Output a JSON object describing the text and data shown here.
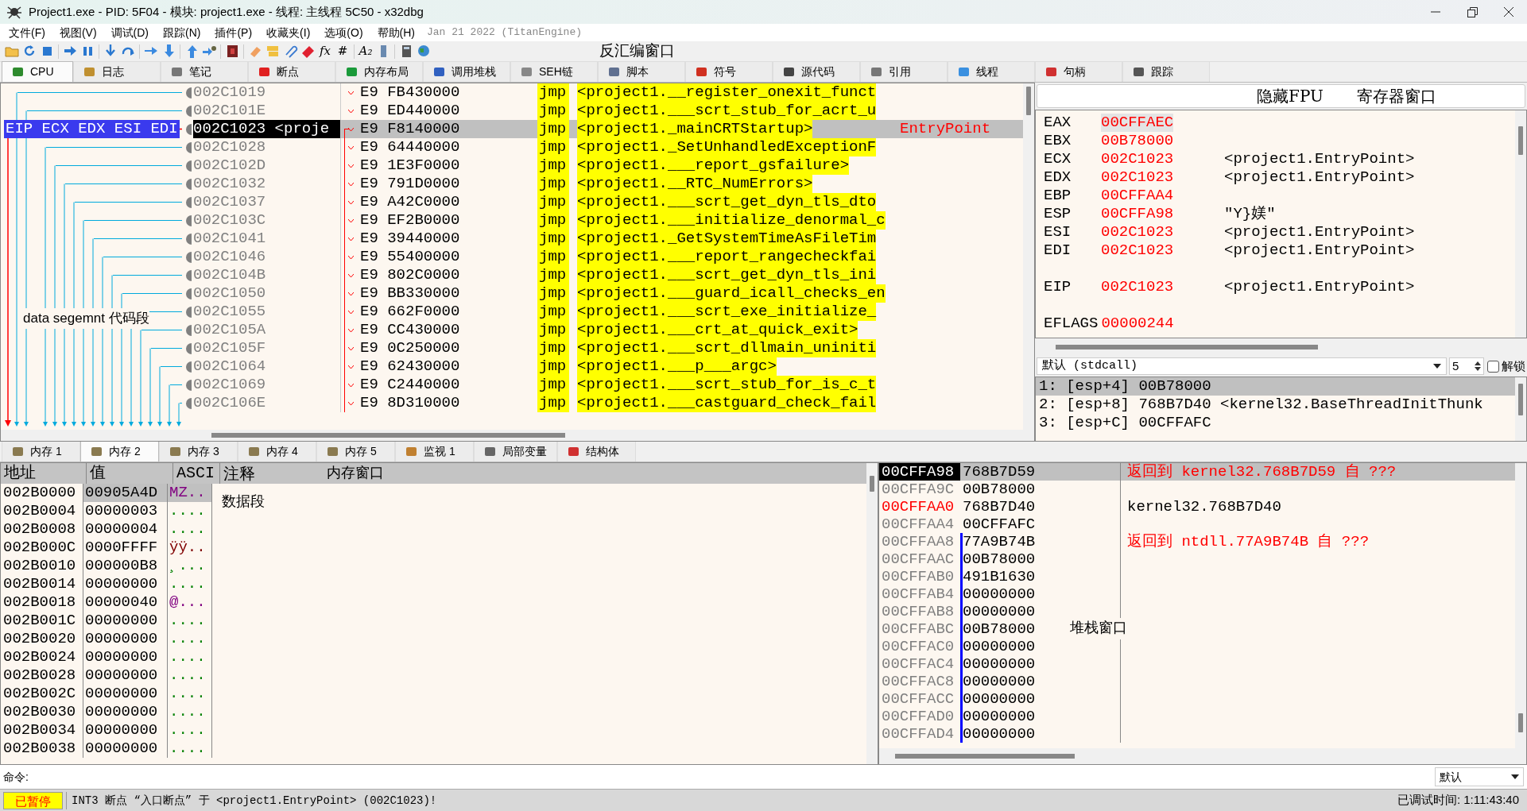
{
  "window": {
    "title": "Project1.exe - PID: 5F04 - 模块: project1.exe - 线程: 主线程 5C50 - x32dbg"
  },
  "menu": {
    "items": [
      "文件(F)",
      "视图(V)",
      "调试(D)",
      "跟踪(N)",
      "插件(P)",
      "收藏夹(I)",
      "选项(O)",
      "帮助(H)"
    ],
    "build_info": "Jan 21 2022 (TitanEngine)"
  },
  "toolbar": {
    "text_buttons": [
      "fx",
      "#",
      "A₂"
    ],
    "annotation": "反汇编窗口"
  },
  "top_tabs": [
    {
      "label": "CPU",
      "selected": true
    },
    {
      "label": "日志",
      "selected": false
    },
    {
      "label": "笔记",
      "selected": false
    },
    {
      "label": "断点",
      "selected": false
    },
    {
      "label": "内存布局",
      "selected": false
    },
    {
      "label": "调用堆栈",
      "selected": false
    },
    {
      "label": "SEH链",
      "selected": false
    },
    {
      "label": "脚本",
      "selected": false
    },
    {
      "label": "符号",
      "selected": false
    },
    {
      "label": "源代码",
      "selected": false
    },
    {
      "label": "引用",
      "selected": false
    },
    {
      "label": "线程",
      "selected": false
    },
    {
      "label": "句柄",
      "selected": false
    },
    {
      "label": "跟踪",
      "selected": false
    }
  ],
  "disassembly": {
    "register_label": "EIP ECX EDX ESI EDI",
    "annotation": "data segemnt 代码段",
    "rows": [
      {
        "address": "002C1019",
        "bytes": "E9 FB430000",
        "mnemonic": "jmp",
        "operand": "<project1.__register_onexit_funct",
        "selected": false
      },
      {
        "address": "002C101E",
        "bytes": "E9 ED440000",
        "mnemonic": "jmp",
        "operand": "<project1.___scrt_stub_for_acrt_u",
        "selected": false
      },
      {
        "address": "002C1023 <proje",
        "bytes": "E9 F8140000",
        "mnemonic": "jmp",
        "operand": "<project1._mainCRTStartup>",
        "comment": "EntryPoint",
        "selected": true
      },
      {
        "address": "002C1028",
        "bytes": "E9 64440000",
        "mnemonic": "jmp",
        "operand": "<project1._SetUnhandledExceptionF",
        "selected": false
      },
      {
        "address": "002C102D",
        "bytes": "E9 1E3F0000",
        "mnemonic": "jmp",
        "operand": "<project1.___report_gsfailure>",
        "selected": false
      },
      {
        "address": "002C1032",
        "bytes": "E9 791D0000",
        "mnemonic": "jmp",
        "operand": "<project1.__RTC_NumErrors>",
        "selected": false
      },
      {
        "address": "002C1037",
        "bytes": "E9 A42C0000",
        "mnemonic": "jmp",
        "operand": "<project1.___scrt_get_dyn_tls_dto",
        "selected": false
      },
      {
        "address": "002C103C",
        "bytes": "E9 EF2B0000",
        "mnemonic": "jmp",
        "operand": "<project1.___initialize_denormal_c",
        "selected": false
      },
      {
        "address": "002C1041",
        "bytes": "E9 39440000",
        "mnemonic": "jmp",
        "operand": "<project1._GetSystemTimeAsFileTim",
        "selected": false
      },
      {
        "address": "002C1046",
        "bytes": "E9 55400000",
        "mnemonic": "jmp",
        "operand": "<project1.___report_rangecheckfai",
        "selected": false
      },
      {
        "address": "002C104B",
        "bytes": "E9 802C0000",
        "mnemonic": "jmp",
        "operand": "<project1.___scrt_get_dyn_tls_ini",
        "selected": false
      },
      {
        "address": "002C1050",
        "bytes": "E9 BB330000",
        "mnemonic": "jmp",
        "operand": "<project1.___guard_icall_checks_en",
        "selected": false
      },
      {
        "address": "002C1055",
        "bytes": "E9 662F0000",
        "mnemonic": "jmp",
        "operand": "<project1.___scrt_exe_initialize_",
        "selected": false
      },
      {
        "address": "002C105A",
        "bytes": "E9 CC430000",
        "mnemonic": "jmp",
        "operand": "<project1.___crt_at_quick_exit>",
        "selected": false
      },
      {
        "address": "002C105F",
        "bytes": "E9 0C250000",
        "mnemonic": "jmp",
        "operand": "<project1.___scrt_dllmain_uniniti",
        "selected": false
      },
      {
        "address": "002C1064",
        "bytes": "E9 62430000",
        "mnemonic": "jmp",
        "operand": "<project1.___p___argc>",
        "selected": false
      },
      {
        "address": "002C1069",
        "bytes": "E9 C2440000",
        "mnemonic": "jmp",
        "operand": "<project1.___scrt_stub_for_is_c_t",
        "selected": false
      },
      {
        "address": "002C106E",
        "bytes": "E9 8D310000",
        "mnemonic": "jmp",
        "operand": "<project1.___castguard_check_fail",
        "selected": false
      }
    ]
  },
  "registers": {
    "fpu_button": "隐藏FPU",
    "annotation": "寄存器窗口",
    "groups": [
      [
        {
          "name": "EAX",
          "value": "00CFFAEC",
          "selected": true
        },
        {
          "name": "EBX",
          "value": "00B78000",
          "selected": false
        },
        {
          "name": "ECX",
          "value": "002C1023",
          "comment": "<project1.EntryPoint>",
          "selected": false
        },
        {
          "name": "EDX",
          "value": "002C1023",
          "comment": "<project1.EntryPoint>",
          "selected": false
        },
        {
          "name": "EBP",
          "value": "00CFFAA4",
          "selected": false
        },
        {
          "name": "ESP",
          "value": "00CFFA98",
          "comment": "\"Y}媄\"",
          "selected": false
        },
        {
          "name": "ESI",
          "value": "002C1023",
          "comment": "<project1.EntryPoint>",
          "selected": false
        },
        {
          "name": "EDI",
          "value": "002C1023",
          "comment": "<project1.EntryPoint>",
          "selected": false
        }
      ],
      [
        {
          "name": "EIP",
          "value": "002C1023",
          "comment": "<project1.EntryPoint>",
          "selected": false
        }
      ],
      [
        {
          "name": "EFLAGS",
          "value": "00000244",
          "selected": false
        }
      ]
    ]
  },
  "call_convention": {
    "value": "默认 (stdcall)",
    "count": "5",
    "unlock": {
      "label": "解锁",
      "checked": false
    }
  },
  "arguments": [
    {
      "text": "1: [esp+4] 00B78000",
      "selected": true
    },
    {
      "text": "2: [esp+8] 768B7D40 <kernel32.BaseThreadInitThunk",
      "selected": false
    },
    {
      "text": "3: [esp+C] 00CFFAFC",
      "selected": false
    }
  ],
  "bottom_tabs": [
    {
      "label": "内存 1",
      "selected": false
    },
    {
      "label": "内存 2",
      "selected": true
    },
    {
      "label": "内存 3",
      "selected": false
    },
    {
      "label": "内存 4",
      "selected": false
    },
    {
      "label": "内存 5",
      "selected": false
    },
    {
      "label": "监视 1",
      "selected": false
    },
    {
      "label": "局部变量",
      "selected": false
    },
    {
      "label": "结构体",
      "selected": false
    }
  ],
  "memory": {
    "columns": [
      "地址",
      "值",
      "ASCI",
      "注释"
    ],
    "annotation": "内存窗口",
    "note": "数据段",
    "rows": [
      {
        "address": "002B0000",
        "value": "00905A4D",
        "ascii": "MZ..",
        "color": "#800080",
        "selected": true
      },
      {
        "address": "002B0004",
        "value": "00000003",
        "ascii": "....",
        "color": "#008000",
        "selected": false
      },
      {
        "address": "002B0008",
        "value": "00000004",
        "ascii": "....",
        "color": "#008000",
        "selected": false
      },
      {
        "address": "002B000C",
        "value": "0000FFFF",
        "ascii": "ÿÿ..",
        "color": "#800000",
        "selected": false
      },
      {
        "address": "002B0010",
        "value": "000000B8",
        "ascii": "¸...",
        "color": "#008000",
        "selected": false
      },
      {
        "address": "002B0014",
        "value": "00000000",
        "ascii": "....",
        "color": "#008000",
        "selected": false
      },
      {
        "address": "002B0018",
        "value": "00000040",
        "ascii": "@...",
        "color": "#800080",
        "selected": false
      },
      {
        "address": "002B001C",
        "value": "00000000",
        "ascii": "....",
        "color": "#008000",
        "selected": false
      },
      {
        "address": "002B0020",
        "value": "00000000",
        "ascii": "....",
        "color": "#008000",
        "selected": false
      },
      {
        "address": "002B0024",
        "value": "00000000",
        "ascii": "....",
        "color": "#008000",
        "selected": false
      },
      {
        "address": "002B0028",
        "value": "00000000",
        "ascii": "....",
        "color": "#008000",
        "selected": false
      },
      {
        "address": "002B002C",
        "value": "00000000",
        "ascii": "....",
        "color": "#008000",
        "selected": false
      },
      {
        "address": "002B0030",
        "value": "00000000",
        "ascii": "....",
        "color": "#008000",
        "selected": false
      },
      {
        "address": "002B0034",
        "value": "00000000",
        "ascii": "....",
        "color": "#008000",
        "selected": false
      },
      {
        "address": "002B0038",
        "value": "00000000",
        "ascii": "....",
        "color": "#008000",
        "selected": false
      }
    ]
  },
  "stack": {
    "annotation": "堆栈窗口",
    "rows": [
      {
        "address": "00CFFA98",
        "value": "768B7D59",
        "comment": "返回到 kernel32.768B7D59 自 ???",
        "kind": "return",
        "selected": true,
        "marked": false
      },
      {
        "address": "00CFFA9C",
        "value": "00B78000",
        "selected": false,
        "marked": false
      },
      {
        "address": "00CFFAA0",
        "value": "768B7D40",
        "comment": "kernel32.768B7D40",
        "kind": "label",
        "selected": false,
        "marked": true
      },
      {
        "address": "00CFFAA4",
        "value": "00CFFAFC",
        "selected": false,
        "marked": false
      },
      {
        "address": "00CFFAA8",
        "value": "77A9B74B",
        "comment": "返回到 ntdll.77A9B74B 自 ???",
        "kind": "return",
        "selected": false,
        "marked": false
      },
      {
        "address": "00CFFAAC",
        "value": "00B78000",
        "selected": false,
        "marked": false
      },
      {
        "address": "00CFFAB0",
        "value": "491B1630",
        "selected": false,
        "marked": false
      },
      {
        "address": "00CFFAB4",
        "value": "00000000",
        "selected": false,
        "marked": false
      },
      {
        "address": "00CFFAB8",
        "value": "00000000",
        "selected": false,
        "marked": false
      },
      {
        "address": "00CFFABC",
        "value": "00B78000",
        "selected": false,
        "marked": false
      },
      {
        "address": "00CFFAC0",
        "value": "00000000",
        "selected": false,
        "marked": false
      },
      {
        "address": "00CFFAC4",
        "value": "00000000",
        "selected": false,
        "marked": false
      },
      {
        "address": "00CFFAC8",
        "value": "00000000",
        "selected": false,
        "marked": false
      },
      {
        "address": "00CFFACC",
        "value": "00000000",
        "selected": false,
        "marked": false
      },
      {
        "address": "00CFFAD0",
        "value": "00000000",
        "selected": false,
        "marked": false
      },
      {
        "address": "00CFFAD4",
        "value": "00000000",
        "selected": false,
        "marked": false
      }
    ]
  },
  "command": {
    "label": "命令:",
    "mode": "默认"
  },
  "status": {
    "state": "已暂停",
    "message": "INT3 断点 “入口断点” 于 <project1.EntryPoint> (002C1023)!",
    "debug_time": "已调试时间: 1:11:43:40"
  }
}
